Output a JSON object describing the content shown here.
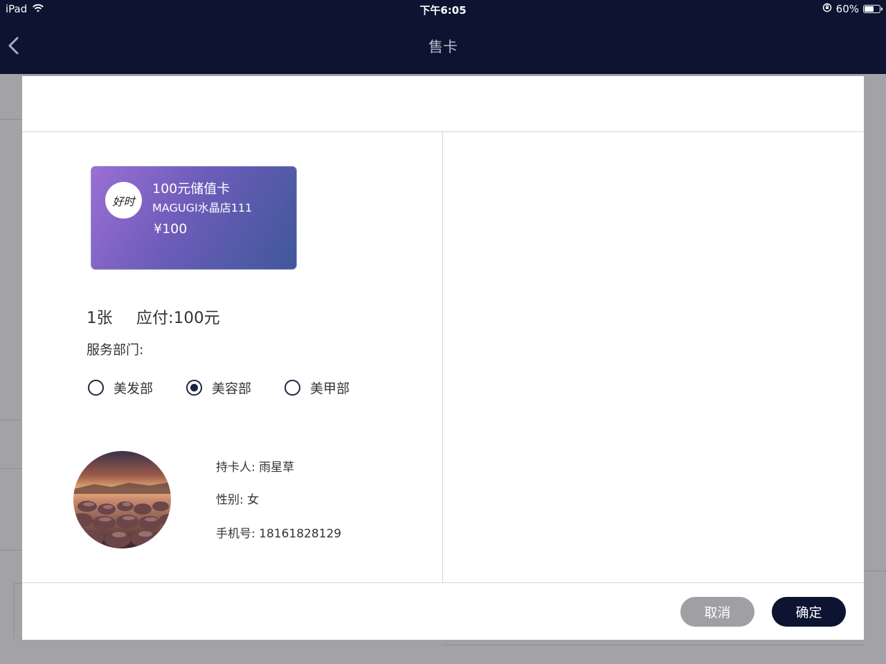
{
  "status_bar": {
    "device": "iPad",
    "time": "下午6:05",
    "battery_percent": "60%"
  },
  "nav": {
    "title": "售卡"
  },
  "card": {
    "name": "100元储值卡",
    "store": "MAGUGI水晶店111",
    "price": "¥100",
    "logo_text": "好时"
  },
  "order": {
    "quantity": "1张",
    "amount_due": "应付:100元"
  },
  "department": {
    "label": "服务部门:",
    "options": [
      "美发部",
      "美容部",
      "美甲部"
    ],
    "selected": "美容部"
  },
  "holder": {
    "name": "持卡人: 雨星草",
    "gender": "性别: 女",
    "phone": "手机号: 18161828129"
  },
  "buttons": {
    "cancel": "取消",
    "confirm": "确定"
  },
  "colors": {
    "nav_bg": "#0c1431",
    "confirm_bg": "#0c1431",
    "cancel_bg": "#a0a0a4",
    "card_gradient_start": "#9a6fd3",
    "card_gradient_end": "#3f5899"
  }
}
